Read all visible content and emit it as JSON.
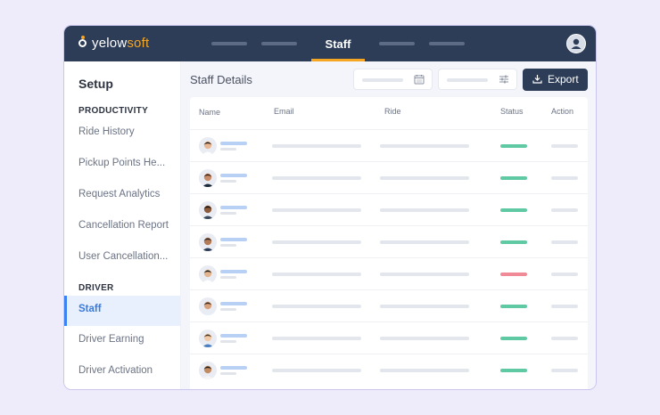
{
  "app": {
    "brand_main": "yelow",
    "brand_accent": "soft",
    "active_tab": "Staff",
    "brand_color": "#f5a623",
    "header_color": "#2d3d57"
  },
  "sidebar": {
    "title": "Setup",
    "sections": [
      {
        "heading": "PRODUCTIVITY",
        "items": [
          "Ride History",
          "Pickup Points He...",
          "Request Analytics",
          "Cancellation Report",
          "User Cancellation..."
        ]
      },
      {
        "heading": "DRIVER",
        "items": [
          "Staff",
          "Driver Earning",
          "Driver Activation"
        ]
      }
    ],
    "active_item": "Staff"
  },
  "main": {
    "title": "Staff Details",
    "export_label": "Export",
    "filters": [
      {
        "icon": "calendar-icon"
      },
      {
        "icon": "filter-sliders-icon"
      }
    ],
    "columns": [
      "Name",
      "Email",
      "Ride",
      "Status",
      "Action"
    ],
    "rows": [
      {
        "status_color": "#5fc9a4"
      },
      {
        "status_color": "#5fc9a4"
      },
      {
        "status_color": "#5fc9a4"
      },
      {
        "status_color": "#5fc9a4"
      },
      {
        "status_color": "#f08a96"
      },
      {
        "status_color": "#5fc9a4"
      },
      {
        "status_color": "#5fc9a4"
      },
      {
        "status_color": "#5fc9a4"
      }
    ]
  }
}
